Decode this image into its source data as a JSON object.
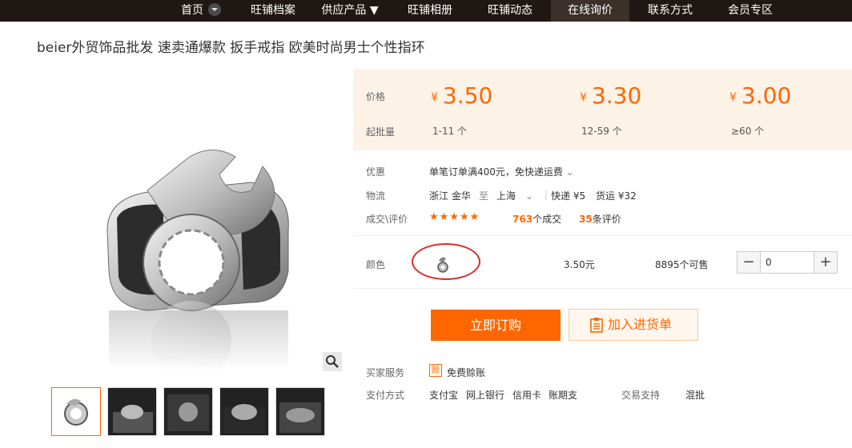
{
  "nav": {
    "items": [
      "首页",
      "旺铺档案",
      "供应产品 ▼",
      "旺铺相册",
      "旺铺动态",
      "在线询价",
      "联系方式",
      "会员专区"
    ]
  },
  "product": {
    "title": "beier外贸饰品批发 速卖通爆款 扳手戒指 欧美时尚男士个性指环"
  },
  "price": {
    "price_label": "价格",
    "moq_label": "起批量",
    "currency": "¥",
    "tiers": [
      {
        "price": "3.50",
        "qty": "1-11 个"
      },
      {
        "price": "3.30",
        "qty": "12-59 个"
      },
      {
        "price": "3.00",
        "qty": "≥60 个"
      }
    ]
  },
  "details": {
    "promo_label": "优惠",
    "promo_text": "单笔订单满400元，免快递运费",
    "logistics_label": "物流",
    "from": "浙江 金华",
    "to_word": "至",
    "to": "上海",
    "express": "快递 ¥5",
    "freight": "货运 ¥32",
    "reviews_label": "成交\\评价",
    "stars": "★★★★★",
    "deals_count": "763",
    "deals_suffix": "个成交",
    "reviews_count": "35",
    "reviews_suffix": "条评价"
  },
  "color_row": {
    "label": "颜色",
    "price": "3.50元",
    "stock": "8895个可售",
    "quantity": "0"
  },
  "actions": {
    "buy": "立即订购",
    "cart": "加入进货单"
  },
  "service": {
    "buyer_label": "买家服务",
    "badge": "赊",
    "buyer_service": "免费赊账",
    "pay_label": "支付方式",
    "pay_methods": [
      "支付宝",
      "网上银行",
      "信用卡",
      "账期支"
    ],
    "trade_label": "交易支持",
    "trade_value": "混批"
  },
  "colors": {
    "accent": "#ff6600",
    "nav_bg": "#1f1714",
    "price_bg": "#fdf2e6"
  }
}
